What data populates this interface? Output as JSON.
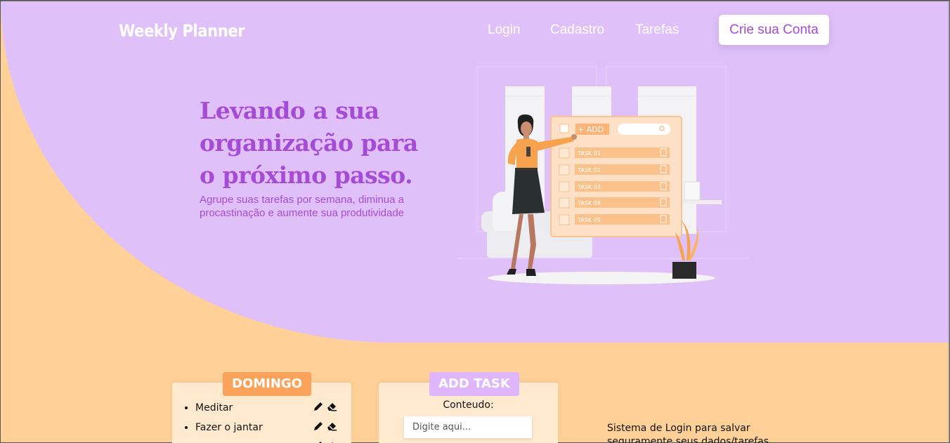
{
  "brand": "Weekly Planner",
  "nav": {
    "login": "Login",
    "signup": "Cadastro",
    "tasks": "Tarefas",
    "cta": "Crie sua Conta"
  },
  "hero": {
    "headline": "Levando a sua organização para o próximo passo.",
    "subtitle": "Agrupe suas tarefas por semana, diminua a procastinação e aumente sua produtividade"
  },
  "illustration": {
    "add_label": "+ ADD",
    "tasks": [
      "TASK 01",
      "TASK 02",
      "TASK 03",
      "TASK 04",
      "TASK 05"
    ]
  },
  "day_card": {
    "day": "DOMINGO",
    "tasks": [
      "Meditar",
      "Fazer o jantar"
    ]
  },
  "add_card": {
    "title": "ADD TASK",
    "content_label": "Conteudo:",
    "placeholder": "Digite aqui..."
  },
  "side_text": "Sistema de Login para salvar seguramente seus dados/tarefas",
  "colors": {
    "purple_bg": "#dfc0f8",
    "orange_bg": "#ffd199",
    "accent": "#a64bd6",
    "tab_orange": "#fba35a",
    "tab_purple": "#dfb6fb"
  }
}
